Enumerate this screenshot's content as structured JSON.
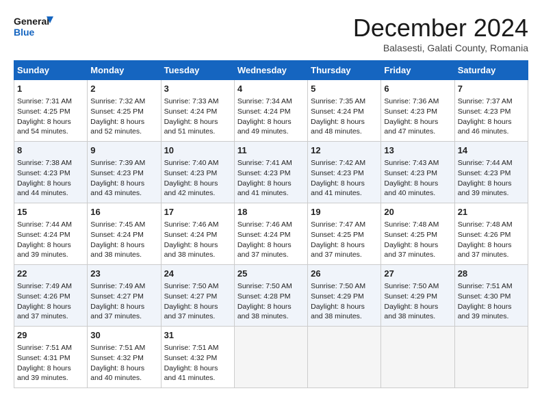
{
  "header": {
    "logo_line1": "General",
    "logo_line2": "Blue",
    "month": "December 2024",
    "location": "Balasesti, Galati County, Romania"
  },
  "days_of_week": [
    "Sunday",
    "Monday",
    "Tuesday",
    "Wednesday",
    "Thursday",
    "Friday",
    "Saturday"
  ],
  "weeks": [
    [
      {
        "day": 1,
        "rise": "Sunrise: 7:31 AM",
        "set": "Sunset: 4:25 PM",
        "daylight": "Daylight: 8 hours and 54 minutes."
      },
      {
        "day": 2,
        "rise": "Sunrise: 7:32 AM",
        "set": "Sunset: 4:25 PM",
        "daylight": "Daylight: 8 hours and 52 minutes."
      },
      {
        "day": 3,
        "rise": "Sunrise: 7:33 AM",
        "set": "Sunset: 4:24 PM",
        "daylight": "Daylight: 8 hours and 51 minutes."
      },
      {
        "day": 4,
        "rise": "Sunrise: 7:34 AM",
        "set": "Sunset: 4:24 PM",
        "daylight": "Daylight: 8 hours and 49 minutes."
      },
      {
        "day": 5,
        "rise": "Sunrise: 7:35 AM",
        "set": "Sunset: 4:24 PM",
        "daylight": "Daylight: 8 hours and 48 minutes."
      },
      {
        "day": 6,
        "rise": "Sunrise: 7:36 AM",
        "set": "Sunset: 4:23 PM",
        "daylight": "Daylight: 8 hours and 47 minutes."
      },
      {
        "day": 7,
        "rise": "Sunrise: 7:37 AM",
        "set": "Sunset: 4:23 PM",
        "daylight": "Daylight: 8 hours and 46 minutes."
      }
    ],
    [
      {
        "day": 8,
        "rise": "Sunrise: 7:38 AM",
        "set": "Sunset: 4:23 PM",
        "daylight": "Daylight: 8 hours and 44 minutes."
      },
      {
        "day": 9,
        "rise": "Sunrise: 7:39 AM",
        "set": "Sunset: 4:23 PM",
        "daylight": "Daylight: 8 hours and 43 minutes."
      },
      {
        "day": 10,
        "rise": "Sunrise: 7:40 AM",
        "set": "Sunset: 4:23 PM",
        "daylight": "Daylight: 8 hours and 42 minutes."
      },
      {
        "day": 11,
        "rise": "Sunrise: 7:41 AM",
        "set": "Sunset: 4:23 PM",
        "daylight": "Daylight: 8 hours and 41 minutes."
      },
      {
        "day": 12,
        "rise": "Sunrise: 7:42 AM",
        "set": "Sunset: 4:23 PM",
        "daylight": "Daylight: 8 hours and 41 minutes."
      },
      {
        "day": 13,
        "rise": "Sunrise: 7:43 AM",
        "set": "Sunset: 4:23 PM",
        "daylight": "Daylight: 8 hours and 40 minutes."
      },
      {
        "day": 14,
        "rise": "Sunrise: 7:44 AM",
        "set": "Sunset: 4:23 PM",
        "daylight": "Daylight: 8 hours and 39 minutes."
      }
    ],
    [
      {
        "day": 15,
        "rise": "Sunrise: 7:44 AM",
        "set": "Sunset: 4:24 PM",
        "daylight": "Daylight: 8 hours and 39 minutes."
      },
      {
        "day": 16,
        "rise": "Sunrise: 7:45 AM",
        "set": "Sunset: 4:24 PM",
        "daylight": "Daylight: 8 hours and 38 minutes."
      },
      {
        "day": 17,
        "rise": "Sunrise: 7:46 AM",
        "set": "Sunset: 4:24 PM",
        "daylight": "Daylight: 8 hours and 38 minutes."
      },
      {
        "day": 18,
        "rise": "Sunrise: 7:46 AM",
        "set": "Sunset: 4:24 PM",
        "daylight": "Daylight: 8 hours and 37 minutes."
      },
      {
        "day": 19,
        "rise": "Sunrise: 7:47 AM",
        "set": "Sunset: 4:25 PM",
        "daylight": "Daylight: 8 hours and 37 minutes."
      },
      {
        "day": 20,
        "rise": "Sunrise: 7:48 AM",
        "set": "Sunset: 4:25 PM",
        "daylight": "Daylight: 8 hours and 37 minutes."
      },
      {
        "day": 21,
        "rise": "Sunrise: 7:48 AM",
        "set": "Sunset: 4:26 PM",
        "daylight": "Daylight: 8 hours and 37 minutes."
      }
    ],
    [
      {
        "day": 22,
        "rise": "Sunrise: 7:49 AM",
        "set": "Sunset: 4:26 PM",
        "daylight": "Daylight: 8 hours and 37 minutes."
      },
      {
        "day": 23,
        "rise": "Sunrise: 7:49 AM",
        "set": "Sunset: 4:27 PM",
        "daylight": "Daylight: 8 hours and 37 minutes."
      },
      {
        "day": 24,
        "rise": "Sunrise: 7:50 AM",
        "set": "Sunset: 4:27 PM",
        "daylight": "Daylight: 8 hours and 37 minutes."
      },
      {
        "day": 25,
        "rise": "Sunrise: 7:50 AM",
        "set": "Sunset: 4:28 PM",
        "daylight": "Daylight: 8 hours and 38 minutes."
      },
      {
        "day": 26,
        "rise": "Sunrise: 7:50 AM",
        "set": "Sunset: 4:29 PM",
        "daylight": "Daylight: 8 hours and 38 minutes."
      },
      {
        "day": 27,
        "rise": "Sunrise: 7:50 AM",
        "set": "Sunset: 4:29 PM",
        "daylight": "Daylight: 8 hours and 38 minutes."
      },
      {
        "day": 28,
        "rise": "Sunrise: 7:51 AM",
        "set": "Sunset: 4:30 PM",
        "daylight": "Daylight: 8 hours and 39 minutes."
      }
    ],
    [
      {
        "day": 29,
        "rise": "Sunrise: 7:51 AM",
        "set": "Sunset: 4:31 PM",
        "daylight": "Daylight: 8 hours and 39 minutes."
      },
      {
        "day": 30,
        "rise": "Sunrise: 7:51 AM",
        "set": "Sunset: 4:32 PM",
        "daylight": "Daylight: 8 hours and 40 minutes."
      },
      {
        "day": 31,
        "rise": "Sunrise: 7:51 AM",
        "set": "Sunset: 4:32 PM",
        "daylight": "Daylight: 8 hours and 41 minutes."
      },
      null,
      null,
      null,
      null
    ]
  ]
}
